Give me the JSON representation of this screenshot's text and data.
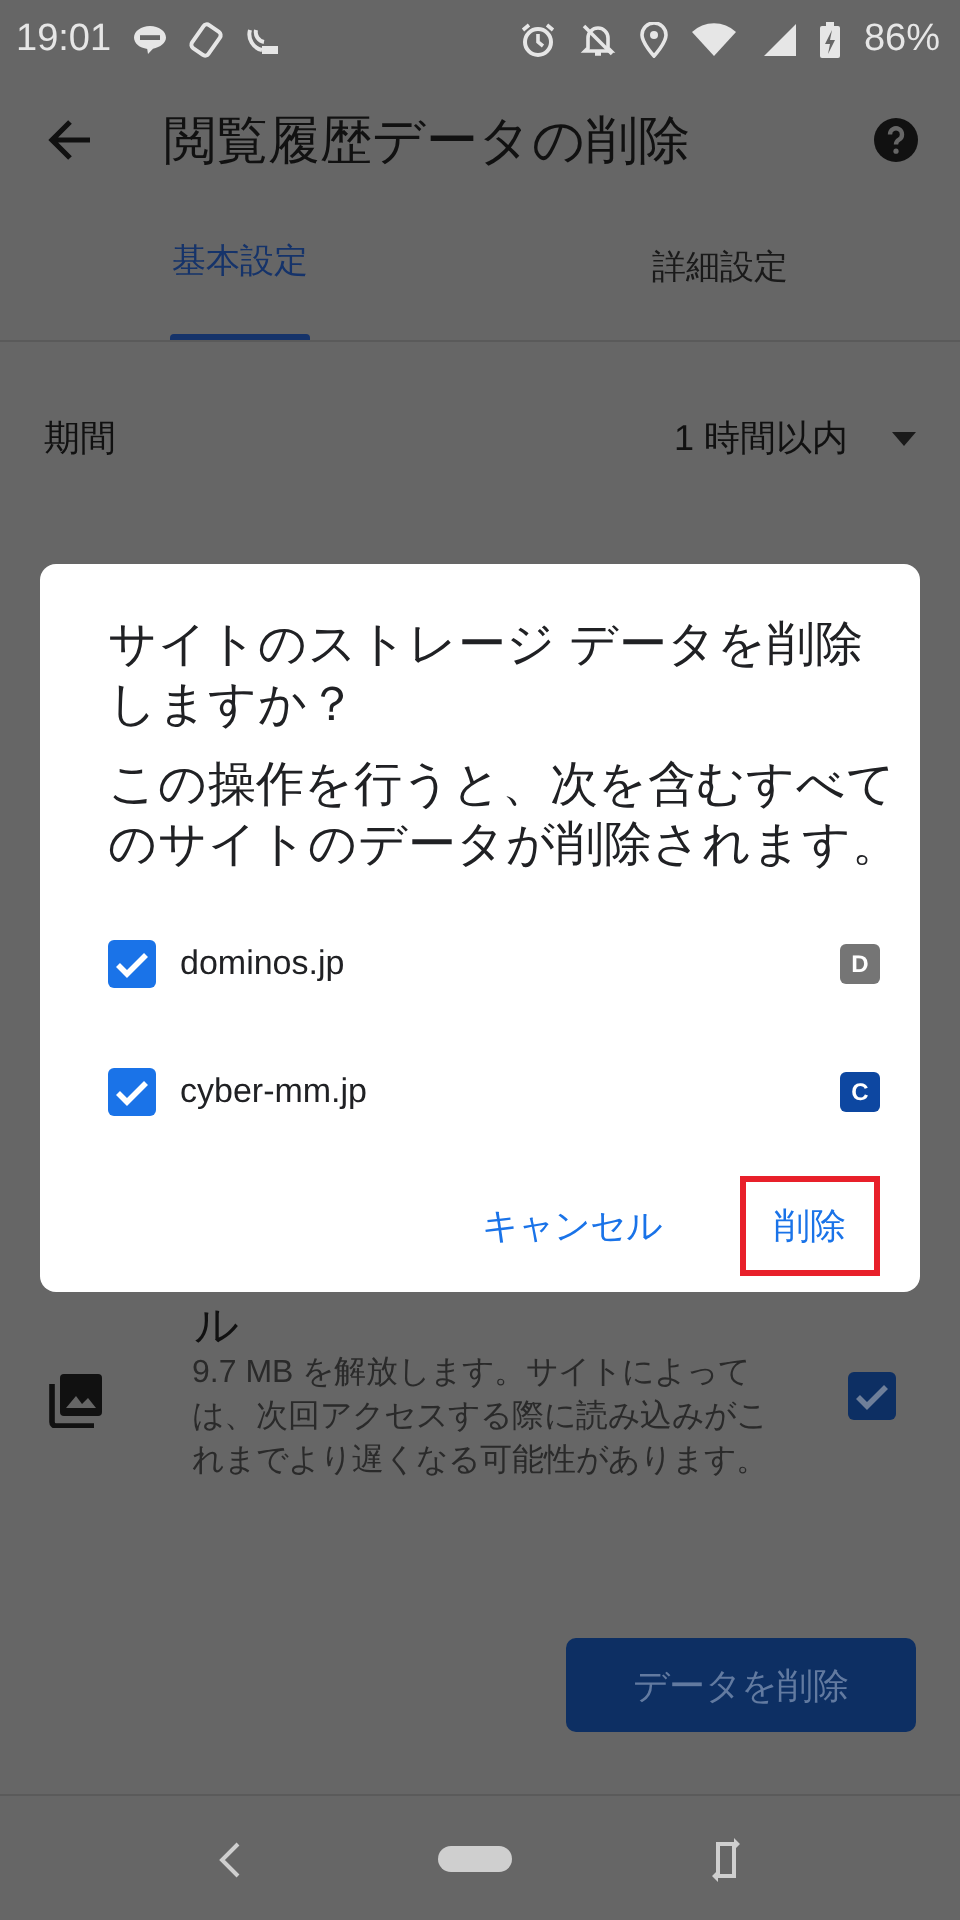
{
  "status_bar": {
    "time": "19:01",
    "battery": "86%"
  },
  "toolbar": {
    "title": "閲覧履歴データの削除"
  },
  "tabs": [
    {
      "label": "基本設定",
      "selected": true
    },
    {
      "label": "詳細設定",
      "selected": false
    }
  ],
  "time_range": {
    "label": "期間",
    "value": "1 時間以内"
  },
  "background_item": {
    "title_fragment": "ル",
    "description": "9.7 MB を解放します。サイトによっては、次回アクセスする際に読み込みがこれまでより遅くなる可能性があります。",
    "checked": true
  },
  "clear_button": "データを削除",
  "dialog": {
    "title": "サイトのストレージ データを削除しますか？",
    "message": "この操作を行うと、次を含むすべてのサイトのデータが削除されます。",
    "sites": [
      {
        "name": "dominos.jp",
        "checked": true,
        "favicon_letter": "D",
        "color": "#757575"
      },
      {
        "name": "cyber-mm.jp",
        "checked": true,
        "favicon_letter": "C",
        "color": "#0d47a1"
      }
    ],
    "buttons": [
      {
        "label": "キャンセル",
        "highlighted": false
      },
      {
        "label": "削除",
        "highlighted": true
      }
    ]
  }
}
